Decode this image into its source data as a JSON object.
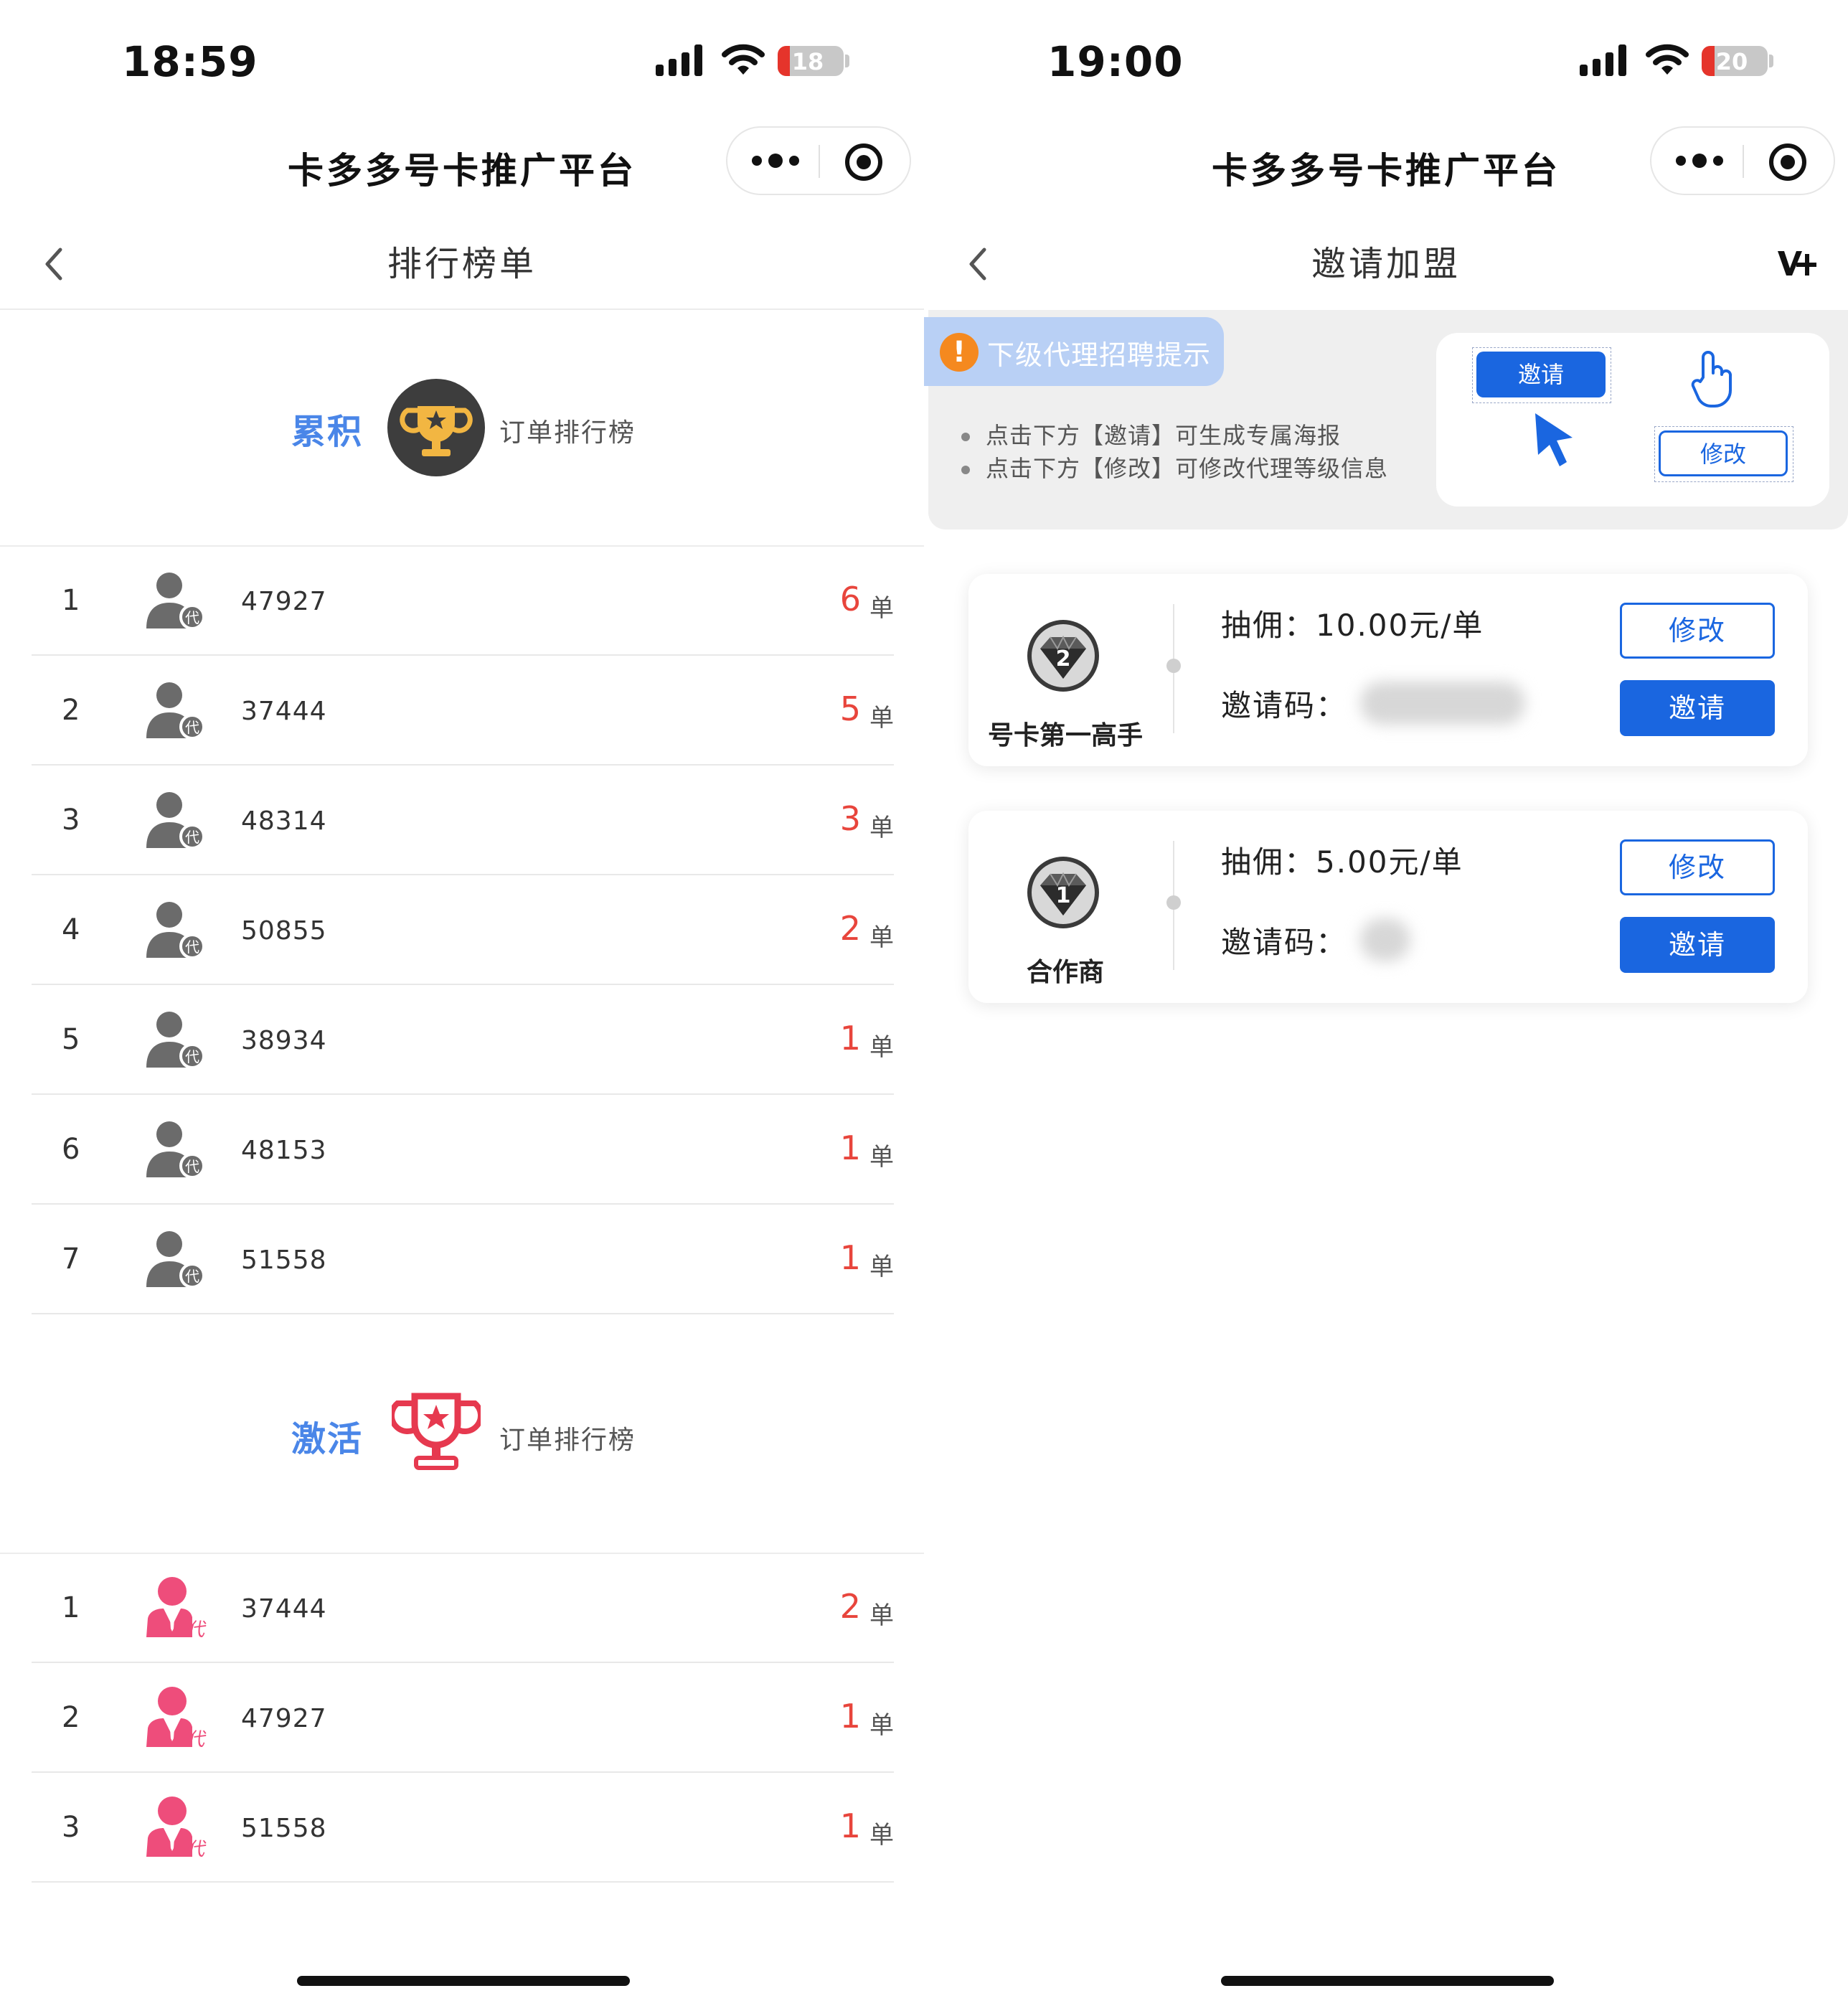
{
  "left": {
    "status": {
      "time": "18:59",
      "battery": "18",
      "battery_level": 0.18
    },
    "app_title": "卡多多号卡推广平台",
    "page_title": "排行榜单",
    "cumulative": {
      "label": "累积",
      "caption": "订单排行榜",
      "rows": [
        {
          "rank": "1",
          "id": "47927",
          "count": "6",
          "unit": "单"
        },
        {
          "rank": "2",
          "id": "37444",
          "count": "5",
          "unit": "单"
        },
        {
          "rank": "3",
          "id": "48314",
          "count": "3",
          "unit": "单"
        },
        {
          "rank": "4",
          "id": "50855",
          "count": "2",
          "unit": "单"
        },
        {
          "rank": "5",
          "id": "38934",
          "count": "1",
          "unit": "单"
        },
        {
          "rank": "6",
          "id": "48153",
          "count": "1",
          "unit": "单"
        },
        {
          "rank": "7",
          "id": "51558",
          "count": "1",
          "unit": "单"
        }
      ]
    },
    "activation": {
      "label": "激活",
      "caption": "订单排行榜",
      "rows": [
        {
          "rank": "1",
          "id": "37444",
          "count": "2",
          "unit": "单"
        },
        {
          "rank": "2",
          "id": "47927",
          "count": "1",
          "unit": "单"
        },
        {
          "rank": "3",
          "id": "51558",
          "count": "1",
          "unit": "单"
        }
      ]
    }
  },
  "right": {
    "status": {
      "time": "19:00",
      "battery": "20",
      "battery_level": 0.2
    },
    "app_title": "卡多多号卡推广平台",
    "page_title": "邀请加盟",
    "tip": {
      "title": "下级代理招聘提示",
      "bang": "!",
      "lines": [
        "点击下方【邀请】可生成专属海报",
        "点击下方【修改】可修改代理等级信息"
      ],
      "demo_invite": "邀请",
      "demo_edit": "修改"
    },
    "levels": [
      {
        "badge_num": "2",
        "name": "号卡第一高手",
        "commission": "抽佣：10.00元/单",
        "code_label": "邀请码：",
        "edit": "修改",
        "invite": "邀请"
      },
      {
        "badge_num": "1",
        "name": "合作商",
        "commission": "抽佣：5.00元/单",
        "code_label": "邀请码：",
        "edit": "修改",
        "invite": "邀请"
      }
    ]
  },
  "colors": {
    "accent_blue": "#1a66e0",
    "label_blue": "#4a86e8",
    "count_red": "#e8453c",
    "pink": "#ee4d7b",
    "gold": "#f2b642"
  },
  "icons": [
    "back-chevron-icon",
    "more-dots-icon",
    "target-icon",
    "trophy-icon",
    "user-agent-icon",
    "warning-icon",
    "cursor-icon",
    "hand-pointer-icon",
    "diamond-badge-icon",
    "vip-plus-icon"
  ]
}
